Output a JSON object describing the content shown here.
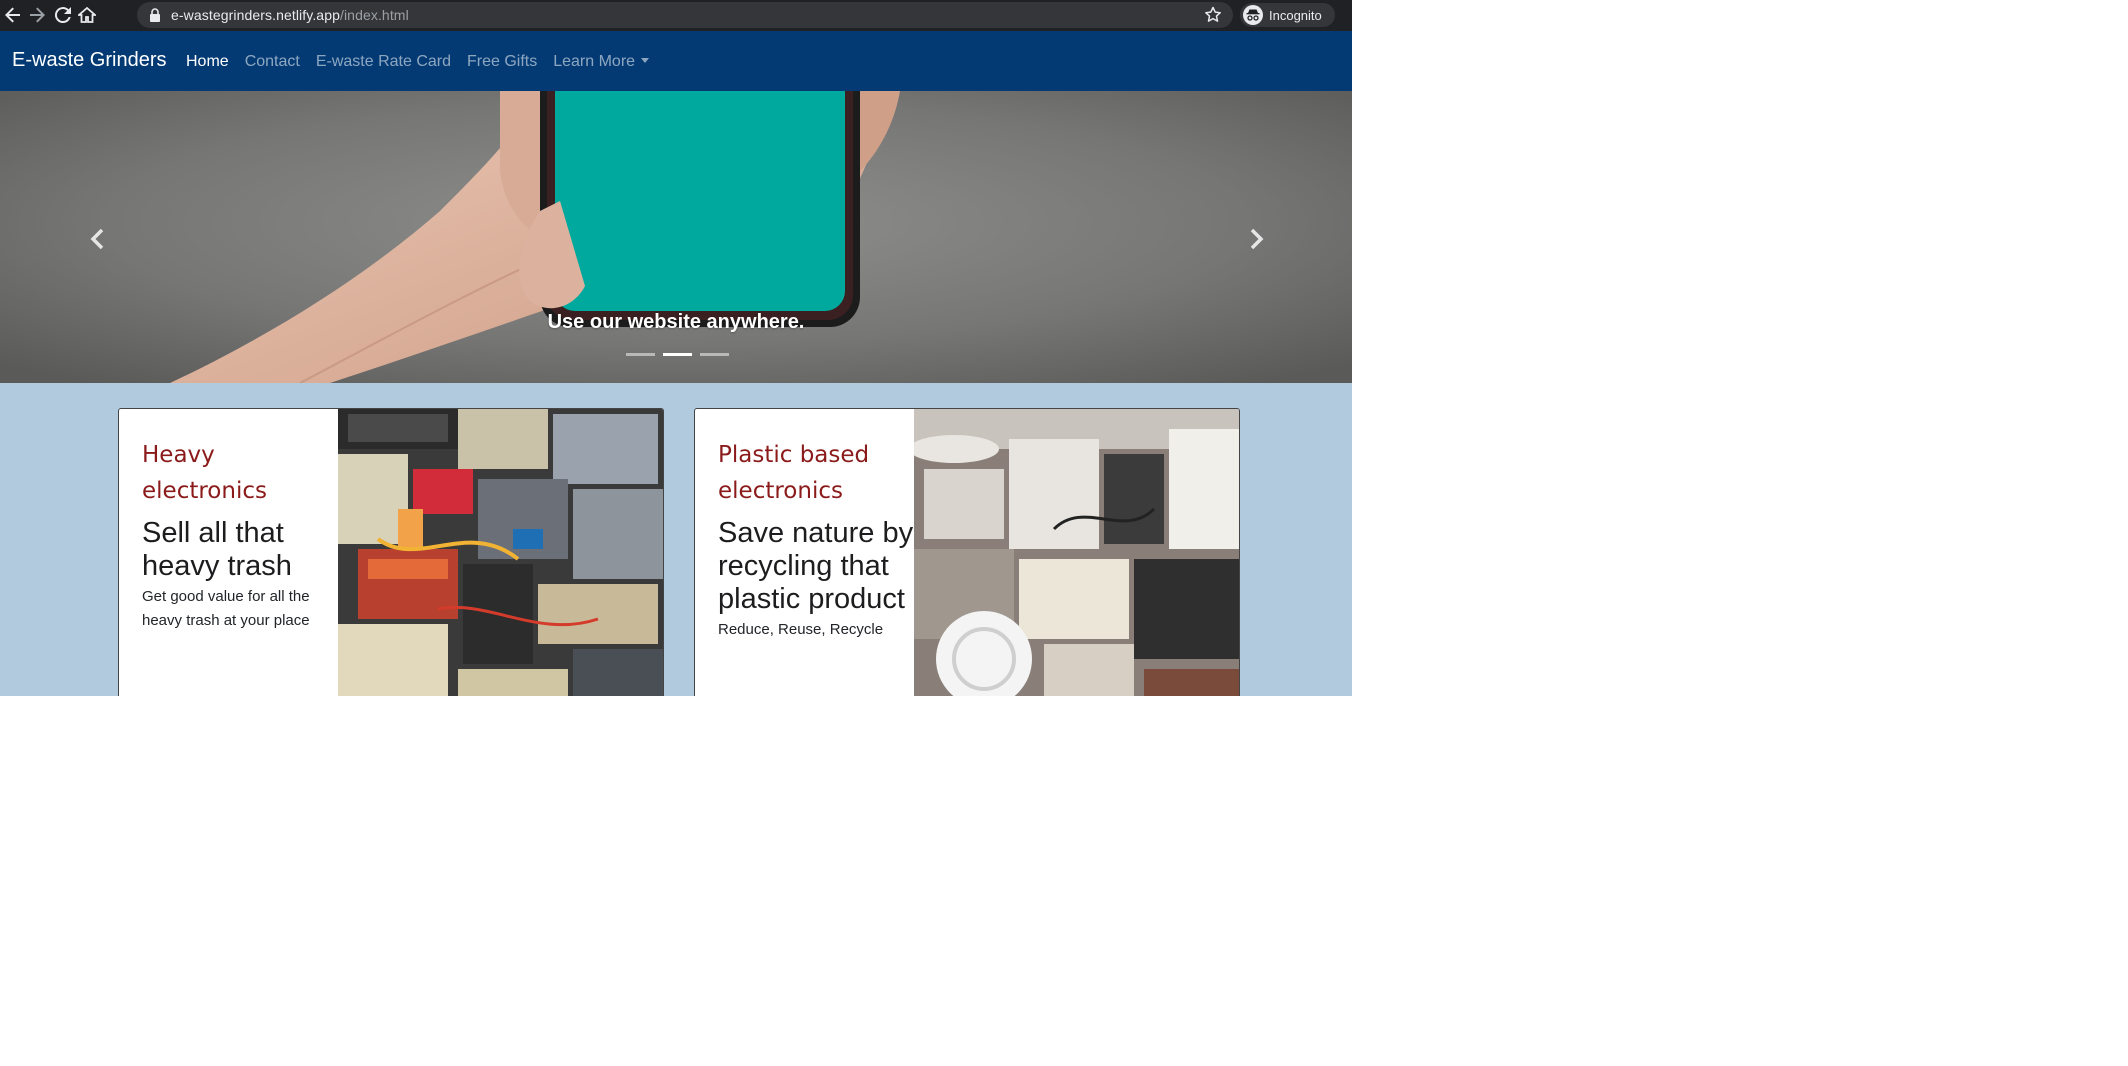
{
  "browser": {
    "url_host": "e-wastegrinders.netlify.app",
    "url_path": "/index.html",
    "profile_label": "Incognito",
    "icons": [
      "back-arrow-icon",
      "forward-arrow-icon",
      "reload-icon",
      "home-icon",
      "lock-icon",
      "star-icon",
      "incognito-icon"
    ]
  },
  "navbar": {
    "brand": "E-waste Grinders",
    "links": [
      "Home",
      "Contact",
      "E-waste Rate Card",
      "Free Gifts",
      "Learn More"
    ],
    "active": "Home",
    "color": "#033a74"
  },
  "carousel": {
    "caption": "Use our website anywhere.",
    "slide_count": 3,
    "active_slide": 2,
    "prev_icon": "chevron-left-icon",
    "next_icon": "chevron-right-icon"
  },
  "cards": [
    {
      "category": "Heavy electronics",
      "title": "Sell all that heavy trash",
      "description": "Get good value for all the heavy trash at your place"
    },
    {
      "category": "Plastic based electronics",
      "title": "Save nature by recycling that plastic product",
      "description": "Reduce, Reuse, Recycle"
    }
  ],
  "colors": {
    "section_background": "#b2cade",
    "category_text": "#8b1a1a"
  }
}
